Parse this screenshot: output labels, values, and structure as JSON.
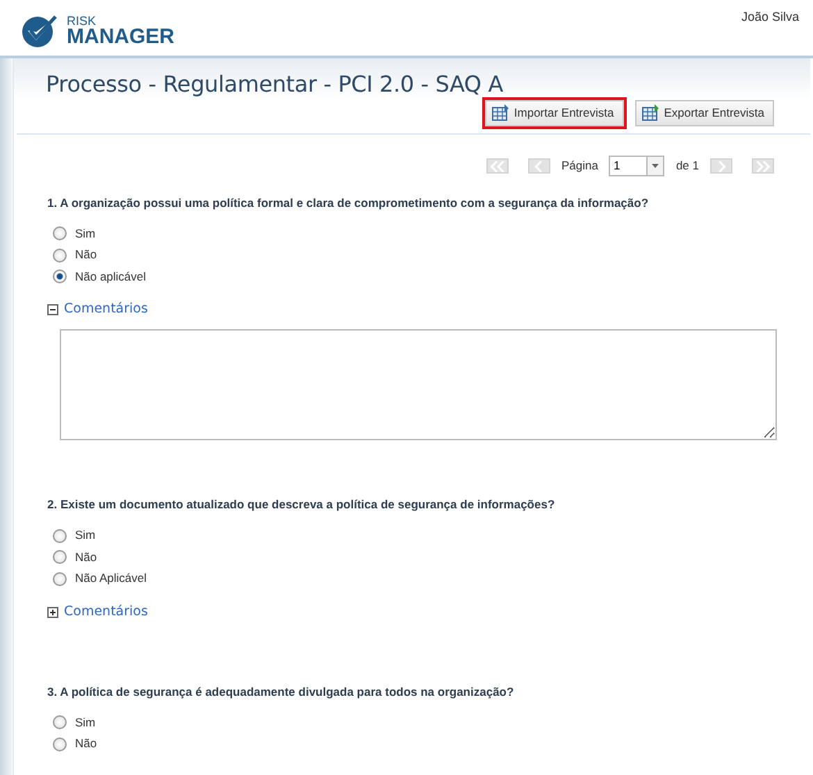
{
  "header": {
    "logo_top": "RISK",
    "logo_bottom": "MANAGER",
    "user": "João Silva"
  },
  "title": "Processo - Regulamentar - PCI 2.0 - SAQ A",
  "toolbar": [
    {
      "label": "Importar Entrevista",
      "highlighted": true
    },
    {
      "label": "Exportar Entrevista",
      "highlighted": false
    }
  ],
  "pager": {
    "label": "Página",
    "value": "1",
    "of": "de 1"
  },
  "questions": [
    {
      "text": "1. A organização possui uma política formal e clara de comprometimento com a segurança da informação?",
      "options": [
        {
          "label": "Sim",
          "selected": false
        },
        {
          "label": "Não",
          "selected": false
        },
        {
          "label": "Não aplicável",
          "selected": true
        }
      ],
      "comments": {
        "label": "Comentários",
        "expanded": true
      }
    },
    {
      "text": "2. Existe um documento atualizado que descreva a política de segurança de informações?",
      "options": [
        {
          "label": "Sim",
          "selected": false
        },
        {
          "label": "Não",
          "selected": false
        },
        {
          "label": "Não Aplicável",
          "selected": false
        }
      ],
      "comments": {
        "label": "Comentários",
        "expanded": false
      }
    },
    {
      "text": "3. A política de segurança é adequadamente divulgada para todos na organização?",
      "options": [
        {
          "label": "Sim",
          "selected": false
        },
        {
          "label": "Não",
          "selected": false
        }
      ]
    }
  ]
}
